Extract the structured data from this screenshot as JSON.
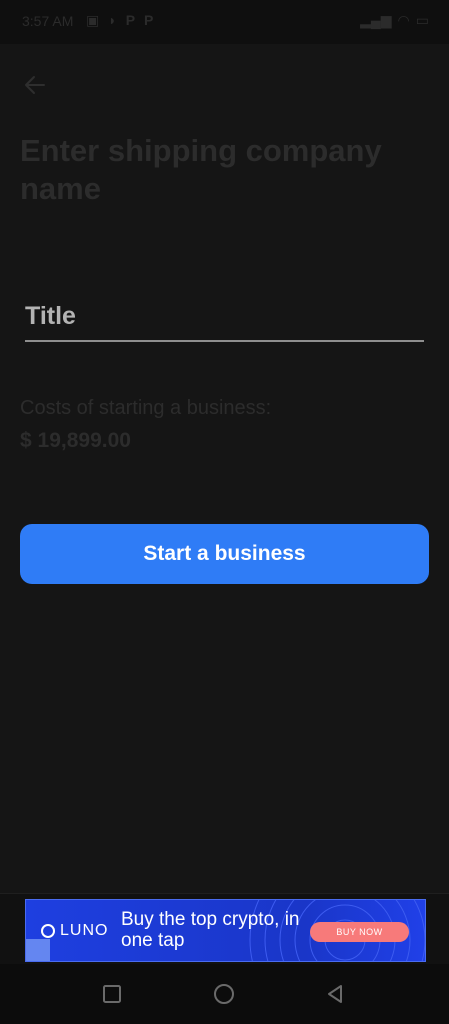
{
  "status_bar": {
    "time": "3:57 AM",
    "left_icons": [
      "status-icon-a",
      "status-icon-b",
      "status-icon-c",
      "status-icon-d"
    ],
    "right_icons": [
      "signal-icon",
      "wifi-icon",
      "battery-icon"
    ]
  },
  "header": {
    "back_icon": "arrow-left-icon",
    "title": "Enter shipping company name"
  },
  "form": {
    "title_placeholder": "Title",
    "title_value": ""
  },
  "cost": {
    "label": "Costs of starting a business:",
    "value": "$ 19,899.00"
  },
  "actions": {
    "start_label": "Start a business"
  },
  "ad": {
    "brand": "LUNO",
    "text": "Buy the top crypto, in one tap",
    "cta": "BUY NOW"
  },
  "nav": {
    "icons": [
      "recents-square-icon",
      "home-circle-icon",
      "back-triangle-icon"
    ]
  },
  "colors": {
    "background": "#151515",
    "primary_button": "#2f7cf6",
    "dim_text": "#2c2c2c",
    "ad_blue": "#1e3fe0",
    "ad_cta": "#f77a7a"
  }
}
